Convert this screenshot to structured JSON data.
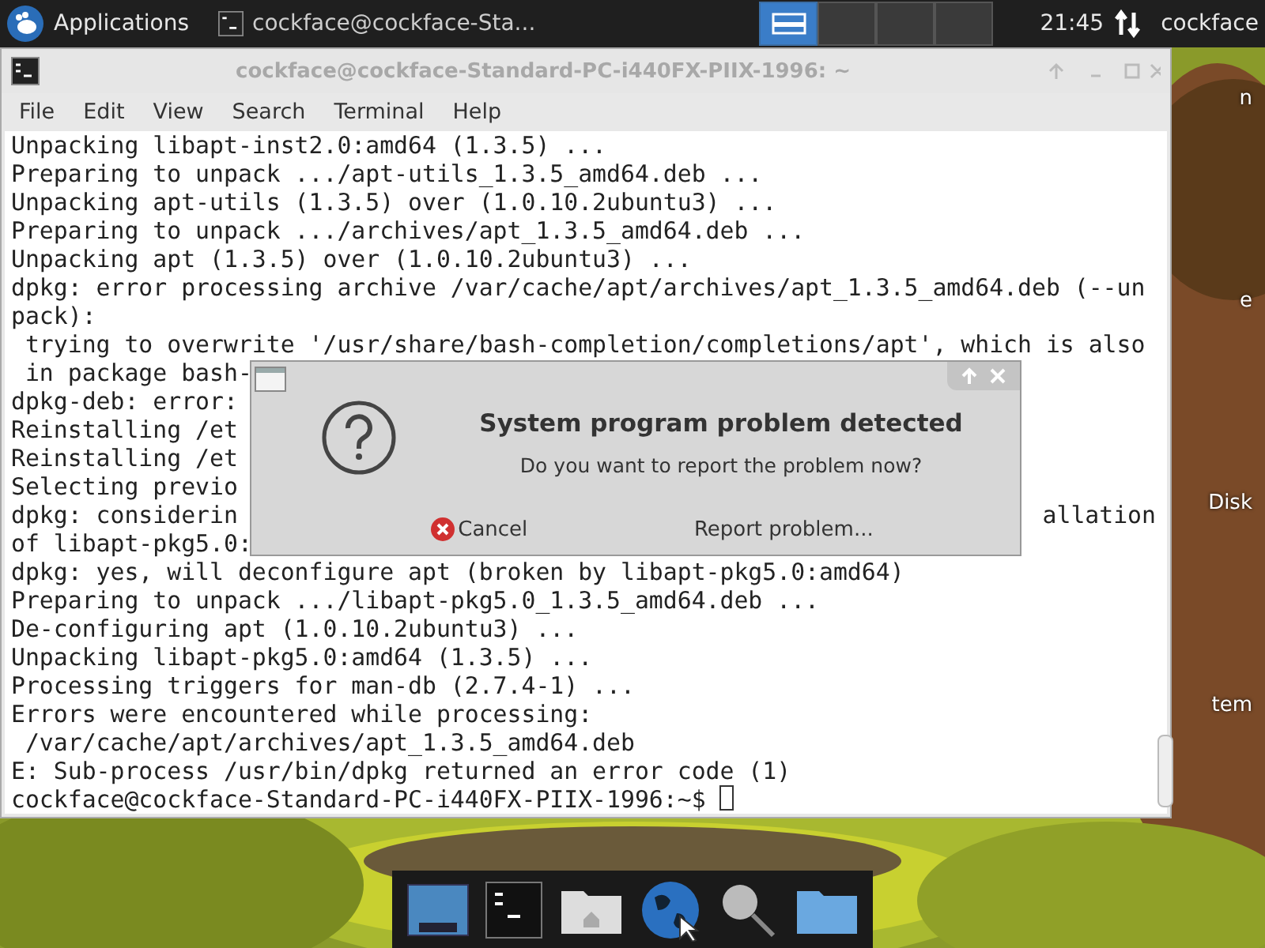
{
  "top_panel": {
    "menu_label": "Applications",
    "task": "cockface@cockface-Sta...",
    "workspaces": [
      {
        "selected": true
      },
      {
        "selected": false
      },
      {
        "selected": false
      },
      {
        "selected": false
      }
    ],
    "clock": "21:45",
    "user": "cockface"
  },
  "desktop_labels": [
    "n",
    "e",
    "Disk",
    "tem"
  ],
  "terminal": {
    "title": "cockface@cockface-Standard-PC-i440FX-PIIX-1996: ~",
    "active": false,
    "menu": [
      "File",
      "Edit",
      "View",
      "Search",
      "Terminal",
      "Help"
    ],
    "lines": [
      {
        "left": "Unpacking libapt-inst2.0:amd64 (1.3.5) ..."
      },
      {
        "left": "Preparing to unpack .../apt-utils_1.3.5_amd64.deb ..."
      },
      {
        "left": "Unpacking apt-utils (1.3.5) over (1.0.10.2ubuntu3) ..."
      },
      {
        "left": "Preparing to unpack .../archives/apt_1.3.5_amd64.deb ..."
      },
      {
        "left": "Unpacking apt (1.3.5) over (1.0.10.2ubuntu3) ..."
      },
      {
        "left": "dpkg: error processing archive /var/cache/apt/archives/apt_1.3.5_amd64.deb (--un"
      },
      {
        "left": "pack):"
      },
      {
        "left": " trying to overwrite '/usr/share/bash-completion/completions/apt', which is also"
      },
      {
        "left": " in package bash-"
      },
      {
        "left": "dpkg-deb: error:"
      },
      {
        "left": "Reinstalling /et"
      },
      {
        "left": "Reinstalling /et"
      },
      {
        "left": "Selecting previo"
      },
      {
        "left": "dpkg: considerin",
        "right": "allation"
      },
      {
        "left": "of libapt-pkg5.0:"
      },
      {
        "left": "dpkg: yes, will deconfigure apt (broken by libapt-pkg5.0:amd64)"
      },
      {
        "left": "Preparing to unpack .../libapt-pkg5.0_1.3.5_amd64.deb ..."
      },
      {
        "left": "De-configuring apt (1.0.10.2ubuntu3) ..."
      },
      {
        "left": "Unpacking libapt-pkg5.0:amd64 (1.3.5) ..."
      },
      {
        "left": "Processing triggers for man-db (2.7.4-1) ..."
      },
      {
        "left": "Errors were encountered while processing:"
      },
      {
        "left": " /var/cache/apt/archives/apt_1.3.5_amd64.deb"
      },
      {
        "left": "E: Sub-process /usr/bin/dpkg returned an error code (1)"
      }
    ],
    "prompt": "cockface@cockface-Standard-PC-i440FX-PIIX-1996:~$"
  },
  "dialog": {
    "title": "System program problem detected",
    "message": "Do you want to report the problem now?",
    "buttons": [
      {
        "label": "Cancel",
        "kind": "cancel"
      },
      {
        "label": "Report problem...",
        "kind": "plain"
      }
    ]
  }
}
